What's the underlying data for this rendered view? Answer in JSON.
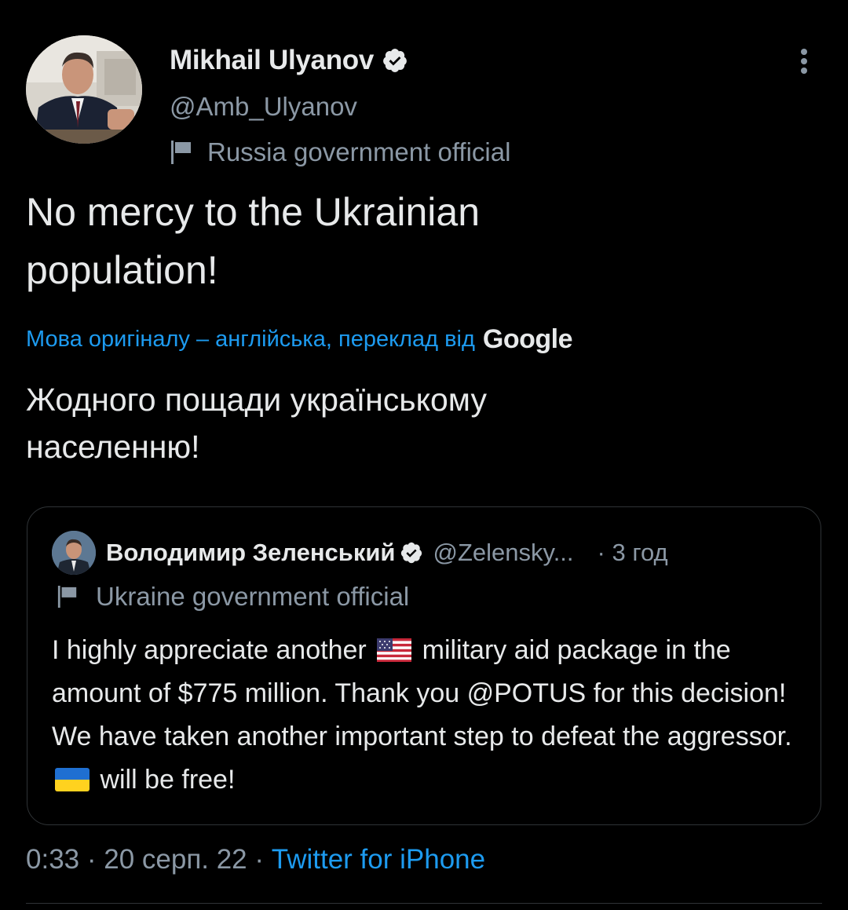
{
  "author": {
    "name": "Mikhail Ulyanov",
    "handle": "@Amb_Ulyanov",
    "label": "Russia government official",
    "verified_icon": "verified-badge-icon"
  },
  "tweet": {
    "line1": "No mercy to the Ukrainian",
    "line2": "population!"
  },
  "translation": {
    "label": "Мова оригіналу – англійська, переклад від",
    "provider": "Google",
    "line1": "Жодного пощади українському",
    "line2": "населенню!"
  },
  "quoted": {
    "name": "Володимир Зеленський",
    "handle": "@Zelensky...",
    "time": "· 3 год",
    "label": "Ukraine government official",
    "text_a": "I highly appreciate another",
    "text_b": "military aid package in the amount of $775 million. Thank you @POTUS for this decision! We have taken another important step to defeat the aggressor.",
    "text_c": "will be free!",
    "emoji_1": "us-flag-emoji",
    "emoji_2": "ukraine-flag-emoji"
  },
  "meta": {
    "time": "0:33",
    "sep1": " · ",
    "date": "20 серп. 22",
    "sep2": " · ",
    "source": "Twitter for iPhone"
  },
  "colors": {
    "background": "#000000",
    "text": "#e7e9ea",
    "secondary": "#8b98a5",
    "link": "#1d9bf0",
    "border": "#2f3336"
  }
}
